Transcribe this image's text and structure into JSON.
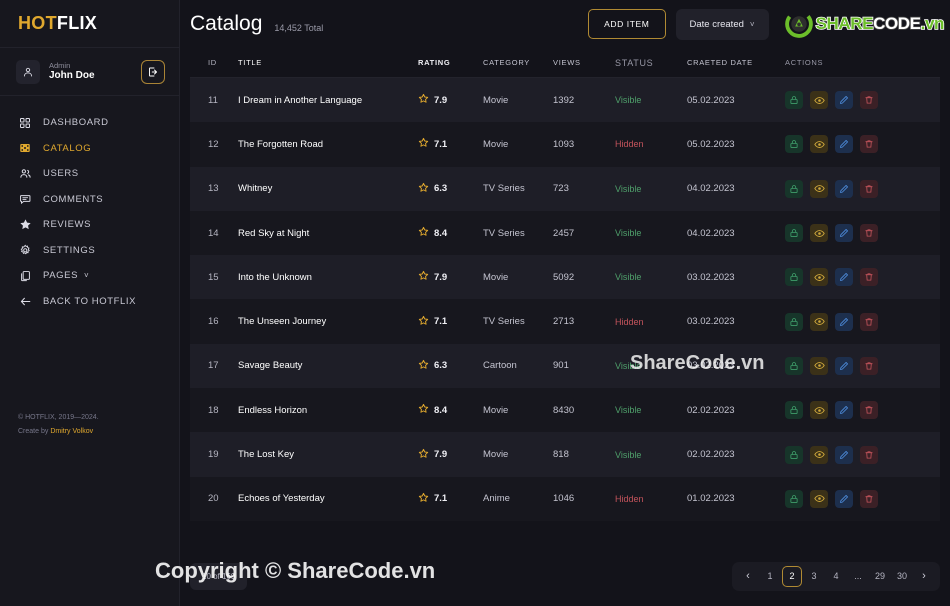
{
  "brand": {
    "hot": "HOT",
    "flix": "FLIX"
  },
  "user": {
    "role": "Admin",
    "name": "John Doe",
    "logout_icon": "logout-icon"
  },
  "sidebar": {
    "items": [
      {
        "label": "DASHBOARD",
        "icon": "grid-icon",
        "active": false
      },
      {
        "label": "CATALOG",
        "icon": "film-icon",
        "active": true
      },
      {
        "label": "USERS",
        "icon": "users-icon",
        "active": false
      },
      {
        "label": "COMMENTS",
        "icon": "comment-icon",
        "active": false
      },
      {
        "label": "REVIEWS",
        "icon": "star-icon",
        "active": false
      },
      {
        "label": "SETTINGS",
        "icon": "gear-icon",
        "active": false
      },
      {
        "label": "PAGES",
        "icon": "pages-icon",
        "active": false,
        "chevron": "˅"
      },
      {
        "label": "BACK TO HOTFLIX",
        "icon": "arrow-left-icon",
        "active": false
      }
    ],
    "footer": {
      "copyright": "© HOTFLIX, 2019—2024.",
      "create_by": "Create by",
      "author": "Dmitry Volkov"
    }
  },
  "header": {
    "title": "Catalog",
    "total": "14,452 Total",
    "add_item_label": "ADD ITEM",
    "sort_label": "Date created",
    "sort_chevron": "˅",
    "logo": {
      "share": "SHARE",
      "code": "CODE",
      "vn": ".vn",
      "mark": "sharecode-logo-icon"
    }
  },
  "table": {
    "columns": [
      "ID",
      "TITLE",
      "RATING",
      "CATEGORY",
      "VIEWS",
      "STATUS",
      "CRAETED DATE",
      "ACTIONS"
    ],
    "action_icons": [
      "lock-icon",
      "eye-icon",
      "edit-icon",
      "trash-icon"
    ],
    "rows": [
      {
        "id": "11",
        "title": "I Dream in Another Language",
        "rating": "7.9",
        "category": "Movie",
        "views": "1392",
        "status": "Visible",
        "status_type": "visible",
        "date": "05.02.2023"
      },
      {
        "id": "12",
        "title": "The Forgotten Road",
        "rating": "7.1",
        "category": "Movie",
        "views": "1093",
        "status": "Hidden",
        "status_type": "hidden",
        "date": "05.02.2023"
      },
      {
        "id": "13",
        "title": "Whitney",
        "rating": "6.3",
        "category": "TV Series",
        "views": "723",
        "status": "Visible",
        "status_type": "visible",
        "date": "04.02.2023"
      },
      {
        "id": "14",
        "title": "Red Sky at Night",
        "rating": "8.4",
        "category": "TV Series",
        "views": "2457",
        "status": "Visible",
        "status_type": "visible",
        "date": "04.02.2023"
      },
      {
        "id": "15",
        "title": "Into the Unknown",
        "rating": "7.9",
        "category": "Movie",
        "views": "5092",
        "status": "Visible",
        "status_type": "visible",
        "date": "03.02.2023"
      },
      {
        "id": "16",
        "title": "The Unseen Journey",
        "rating": "7.1",
        "category": "TV Series",
        "views": "2713",
        "status": "Hidden",
        "status_type": "hidden",
        "date": "03.02.2023"
      },
      {
        "id": "17",
        "title": "Savage Beauty",
        "rating": "6.3",
        "category": "Cartoon",
        "views": "901",
        "status": "Visible",
        "status_type": "visible",
        "date": "03.02.2023"
      },
      {
        "id": "18",
        "title": "Endless Horizon",
        "rating": "8.4",
        "category": "Movie",
        "views": "8430",
        "status": "Visible",
        "status_type": "visible",
        "date": "02.02.2023"
      },
      {
        "id": "19",
        "title": "The Lost Key",
        "rating": "7.9",
        "category": "Movie",
        "views": "818",
        "status": "Visible",
        "status_type": "visible",
        "date": "02.02.2023"
      },
      {
        "id": "20",
        "title": "Echoes of Yesterday",
        "rating": "7.1",
        "category": "Anime",
        "views": "1046",
        "status": "Hidden",
        "status_type": "hidden",
        "date": "01.02.2023"
      }
    ]
  },
  "footer": {
    "count": "10 of 169",
    "pagination": {
      "prev": "‹",
      "next": "›",
      "pages": [
        "1",
        "2",
        "3",
        "4",
        "...",
        "29",
        "30"
      ],
      "current": "2"
    }
  },
  "watermarks": {
    "middle": "ShareCode.vn",
    "bottom": "Copyright © ShareCode.vn"
  },
  "colors": {
    "accent": "#e0a82e",
    "visible": "#4fa06b",
    "hidden": "#c4545c",
    "logo_green": "#6cbe2a",
    "bg": "#13131a"
  }
}
